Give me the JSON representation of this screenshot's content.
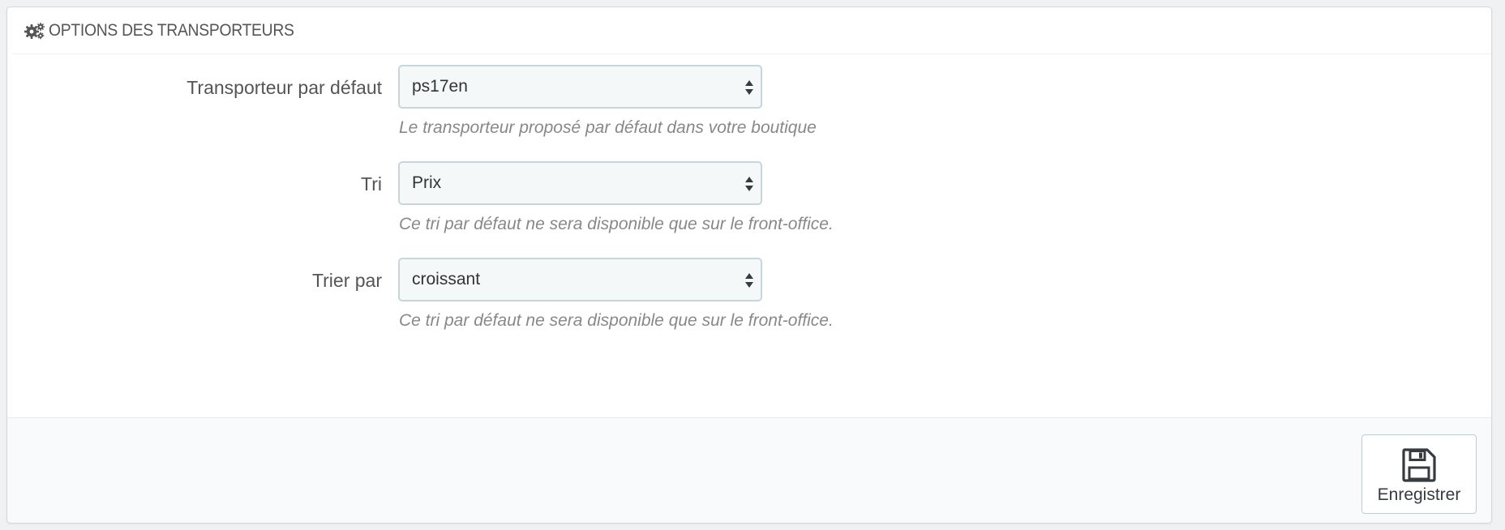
{
  "panel": {
    "title": "OPTIONS DES TRANSPORTEURS",
    "icon": "cogs-icon"
  },
  "fields": [
    {
      "label": "Transporteur par défaut",
      "value": "ps17en",
      "help": "Le transporteur proposé par défaut dans votre boutique"
    },
    {
      "label": "Tri",
      "value": "Prix",
      "help": "Ce tri par défaut ne sera disponible que sur le front-office."
    },
    {
      "label": "Trier par",
      "value": "croissant",
      "help": "Ce tri par défaut ne sera disponible que sur le front-office."
    }
  ],
  "footer": {
    "save_label": "Enregistrer",
    "save_icon": "floppy-disk-icon"
  },
  "colors": {
    "page_background": "#eff1f2",
    "select_background": "#f5f8f9",
    "select_border": "#c7d6db",
    "help_text": "#888888",
    "footer_background": "#f9fafc"
  }
}
